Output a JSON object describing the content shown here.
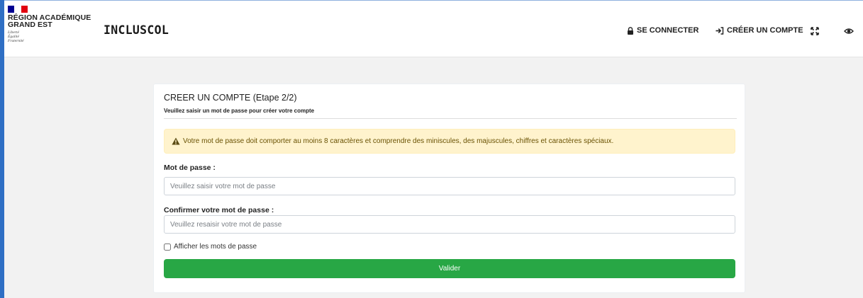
{
  "header": {
    "logo": {
      "flag_colors": [
        "#000091",
        "#ffffff",
        "#e1000f"
      ],
      "region_line1": "RÉGION ACADÉMIQUE",
      "region_line2": "GRAND EST",
      "motto_line1": "Liberté",
      "motto_line2": "Égalité",
      "motto_line3": "Fraternité"
    },
    "brand": "INCLUSCOL",
    "nav": {
      "login": {
        "label": "SE CONNECTER",
        "icon": "lock-icon"
      },
      "register": {
        "label": "CRÉER UN COMPTE",
        "icon": "sign-in-icon"
      },
      "fullscreen_icon": "expand-icon",
      "visibility_icon": "eye-icon"
    }
  },
  "form": {
    "title": "CREER UN COMPTE (Etape 2/2)",
    "subtitle": "Veuillez saisir un mot de passe pour créer votre compte",
    "alert": {
      "icon": "warning-icon",
      "text": "Votre mot de passe doit comporter au moins 8 caractères et comprendre des miniscules, des majuscules, chiffres et caractères spéciaux."
    },
    "password": {
      "label": "Mot de passe :",
      "value": "",
      "placeholder": "Veuillez saisir votre mot de passe"
    },
    "confirm_password": {
      "label": "Confirmer votre mot de passe :",
      "value": "",
      "placeholder": "Veuillez resaisir votre mot de passe"
    },
    "show_passwords": {
      "label": "Afficher les mots de passe",
      "checked": false
    },
    "submit_label": "Valider"
  },
  "colors": {
    "submit_green": "#28a745",
    "alert_background": "#fff3cd",
    "alert_text": "#856404",
    "frame_blue": "#2f6fc4"
  }
}
